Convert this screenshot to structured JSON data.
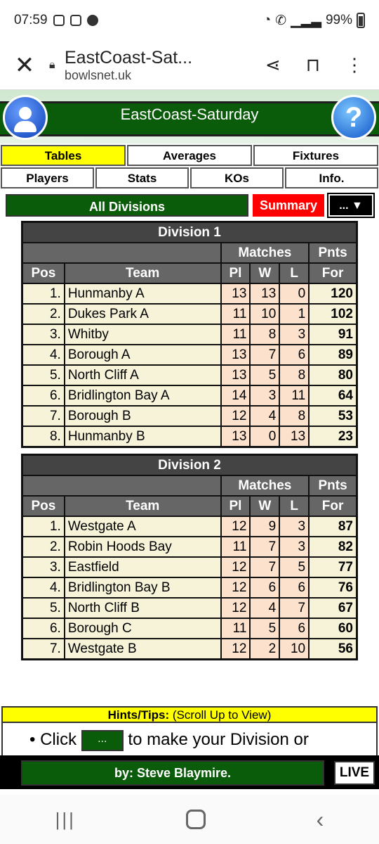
{
  "status": {
    "time": "07:59",
    "battery": "99%"
  },
  "browser": {
    "title": "EastCoast-Sat...",
    "domain": "bowlsnet.uk"
  },
  "app": {
    "title": "EastCoast-Saturday"
  },
  "menu": {
    "row1": [
      "Tables",
      "Averages",
      "Fixtures"
    ],
    "row2": [
      "Players",
      "Stats",
      "KOs",
      "Info."
    ]
  },
  "division_select": {
    "all": "All Divisions",
    "summary": "Summary",
    "more": "... ▼"
  },
  "table_headers": {
    "matches": "Matches",
    "pnts": "Pnts",
    "pos": "Pos",
    "team": "Team",
    "pl": "Pl",
    "w": "W",
    "l": "L",
    "for": "For"
  },
  "divisions": [
    {
      "name": "Division 1",
      "rows": [
        [
          "1.",
          "Hunmanby A",
          "13",
          "13",
          "0",
          "120"
        ],
        [
          "2.",
          "Dukes Park A",
          "11",
          "10",
          "1",
          "102"
        ],
        [
          "3.",
          "Whitby",
          "11",
          "8",
          "3",
          "91"
        ],
        [
          "4.",
          "Borough A",
          "13",
          "7",
          "6",
          "89"
        ],
        [
          "5.",
          "North Cliff A",
          "13",
          "5",
          "8",
          "80"
        ],
        [
          "6.",
          "Bridlington Bay A",
          "14",
          "3",
          "11",
          "64"
        ],
        [
          "7.",
          "Borough B",
          "12",
          "4",
          "8",
          "53"
        ],
        [
          "8.",
          "Hunmanby B",
          "13",
          "0",
          "13",
          "23"
        ]
      ]
    },
    {
      "name": "Division 2",
      "rows": [
        [
          "1.",
          "Westgate A",
          "12",
          "9",
          "3",
          "87"
        ],
        [
          "2.",
          "Robin Hoods Bay",
          "11",
          "7",
          "3",
          "82"
        ],
        [
          "3.",
          "Eastfield",
          "12",
          "7",
          "5",
          "77"
        ],
        [
          "4.",
          "Bridlington Bay B",
          "12",
          "6",
          "6",
          "76"
        ],
        [
          "5.",
          "North Cliff B",
          "12",
          "4",
          "7",
          "67"
        ],
        [
          "6.",
          "Borough C",
          "11",
          "5",
          "6",
          "60"
        ],
        [
          "7.",
          "Westgate B",
          "12",
          "2",
          "10",
          "56"
        ]
      ]
    }
  ],
  "hints": {
    "label": "Hints/Tips:",
    "note": "(Scroll Up to View)",
    "click": "Click",
    "btn": "...",
    "rest": "to make your Division or"
  },
  "footer": {
    "author": "by: Steve Blaymire.",
    "live": "LIVE"
  }
}
